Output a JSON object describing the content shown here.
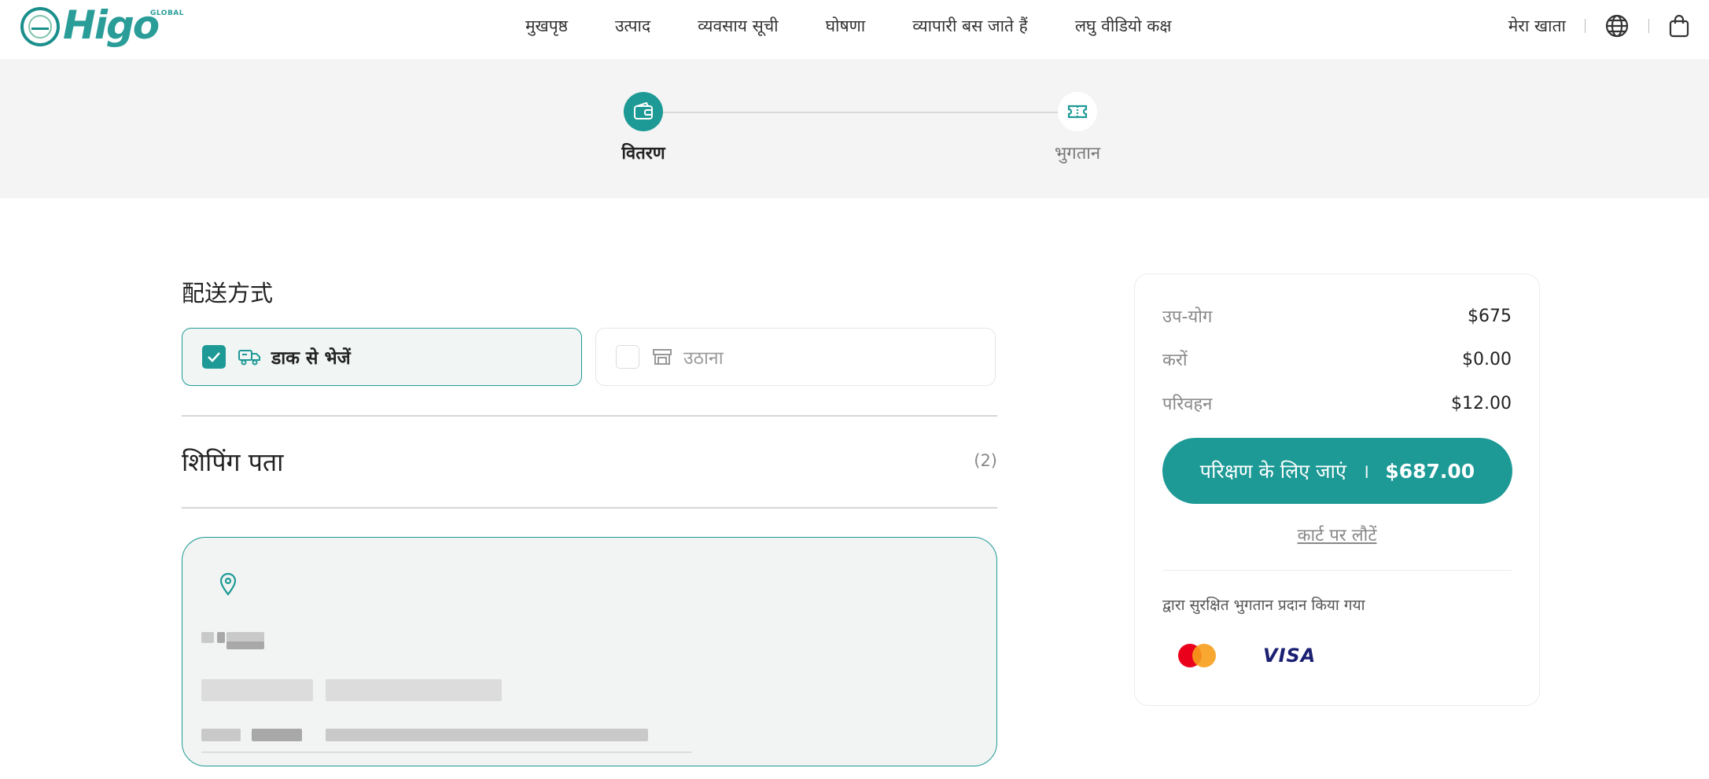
{
  "brand": {
    "name": "Higo",
    "tagline": "GLOBAL"
  },
  "nav": {
    "items": [
      {
        "label": "मुखपृष्ठ"
      },
      {
        "label": "उत्पाद"
      },
      {
        "label": "व्यवसाय सूची"
      },
      {
        "label": "घोषणा"
      },
      {
        "label": "व्यापारी बस जाते हैं"
      },
      {
        "label": "लघु वीडियो कक्ष"
      }
    ],
    "account_label": "मेरा खाता",
    "icons": [
      "globe-icon",
      "shopping-bag-icon"
    ]
  },
  "stepper": {
    "steps": [
      {
        "label": "वितरण",
        "state": "active",
        "icon": "wallet-icon"
      },
      {
        "label": "भुगतान",
        "state": "inactive",
        "icon": "ticket-icon"
      }
    ]
  },
  "delivery": {
    "title": "配送方式",
    "options": [
      {
        "label": "डाक से भेजें",
        "selected": true,
        "icon": "truck-icon"
      },
      {
        "label": "उठाना",
        "selected": false,
        "icon": "store-icon"
      }
    ]
  },
  "shipping_address": {
    "title": "शिपिंग पता",
    "count": "(2)",
    "icon": "location-pin-icon"
  },
  "summary": {
    "rows": [
      {
        "label": "उप-योग",
        "value": "$675"
      },
      {
        "label": "करों",
        "value": "$0.00"
      },
      {
        "label": "परिवहन",
        "value": "$12.00"
      }
    ],
    "checkout_label": "परिक्षण के लिए जाएं",
    "checkout_divider": "।",
    "checkout_total": "$687.00",
    "back_label": "कार्ट पर लौटें",
    "secure_text": "द्वारा सुरक्षित भुगतान प्रदान किया गया",
    "payment_methods": [
      "mastercard",
      "VISA"
    ]
  },
  "colors": {
    "accent": "#1e9a96",
    "band": "#f4f4f4",
    "card_bg": "#f1f4f3"
  }
}
